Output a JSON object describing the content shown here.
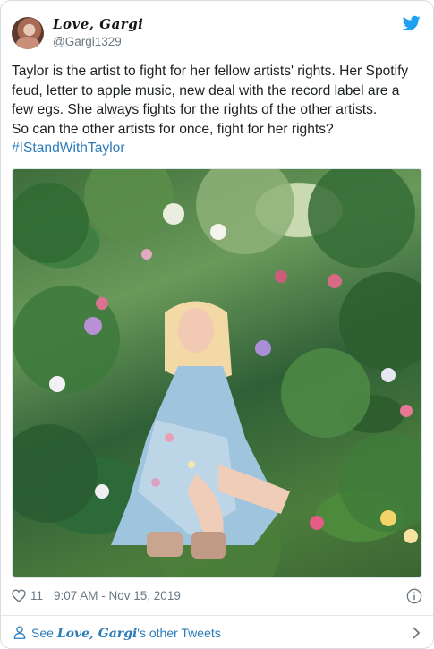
{
  "author": {
    "display_name": "Love, Gargi",
    "handle": "@Gargi1329",
    "avatar_icon": "avatar-photo"
  },
  "tweet": {
    "lines": [
      "Taylor is the artist to fight for her fellow artists' rights. Her Spotify",
      "feud, letter to apple music, new deal with the record label are a",
      "few egs. She always fights for the rights of the other artists.",
      "So can the other artists for once, fight for her rights?"
    ],
    "hashtag": "#IStandWithTaylor"
  },
  "meta": {
    "likes": "11",
    "timestamp": "9:07 AM - Nov 15, 2019"
  },
  "footer": {
    "prefix": "See ",
    "name": "Love, Gargi",
    "suffix": "'s other Tweets"
  },
  "colors": {
    "link": "#2b7bb9",
    "muted": "#697882",
    "twitter_blue": "#1da1f2"
  }
}
